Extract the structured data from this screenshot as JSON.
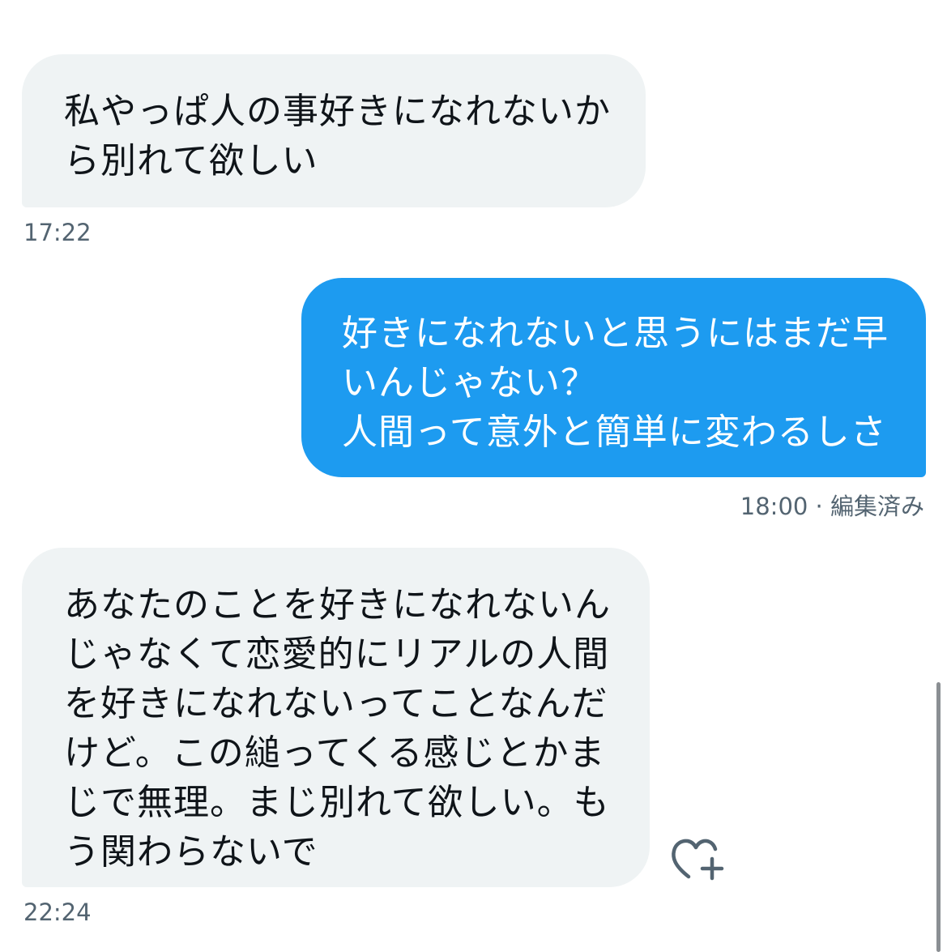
{
  "messages": [
    {
      "direction": "incoming",
      "text": "私やっぱ人の事好きになれないか\nら別れて欲しい",
      "time": "17:22"
    },
    {
      "direction": "outgoing",
      "text": "好きになれないと思うにはまだ早\nいんじゃない？\n人間って意外と簡単に変わるしさ",
      "time": "18:00 · 編集済み"
    },
    {
      "direction": "incoming",
      "text": "あなたのことを好きになれないん\nじゃなくて恋愛的にリアルの人間\nを好きになれないってことなんだ\nけど。この縋ってくる感じとかま\nじで無理。まじ別れて欲しい。も\nう関わらないで",
      "time": "22:24"
    }
  ],
  "colors": {
    "incoming_bubble": "#eff3f4",
    "outgoing_bubble": "#1d9bf0",
    "meta_text": "#536471"
  },
  "icons": {
    "reaction": "heart-plus-icon"
  }
}
